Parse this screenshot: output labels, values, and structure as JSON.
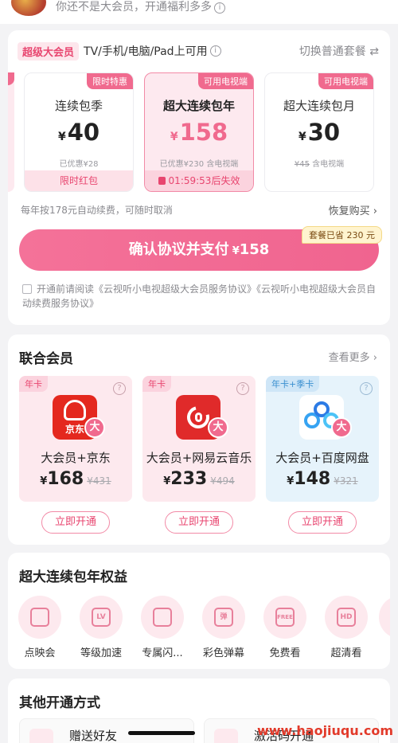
{
  "top": {
    "subtitle": "你还不是大会员，开通福利多多"
  },
  "plans_card": {
    "badge": "超级大会员",
    "devices": "TV/手机/电脑/Pad上可用",
    "switch": "切换普通套餐 ⇄",
    "plans": [
      {
        "tag": "限时特惠",
        "name": "连续包季",
        "currency": "¥",
        "price": "40",
        "note_prefix": "已优惠¥28",
        "note_strike": "",
        "note_suffix": "",
        "bottom": "限时红包"
      },
      {
        "tag": "可用电视端",
        "name": "超大连续包年",
        "currency": "¥",
        "price": "158",
        "note_prefix": "已优惠¥230",
        "note_strike": "",
        "note_suffix": "含电视端",
        "bottom": "01:59:53后失效"
      },
      {
        "tag": "可用电视端",
        "name": "超大连续包月",
        "currency": "¥",
        "price": "30",
        "note_prefix": "",
        "note_strike": "¥45",
        "note_suffix": "含电视端",
        "bottom": ""
      }
    ],
    "renew_note": "每年按178元自动续费，可随时取消",
    "restore": "恢复购买 ›",
    "pay_label": "确认协议并支付",
    "pay_currency": "¥",
    "pay_price": "158",
    "save_chip": "套餐已省 230 元",
    "agreement": "开通前请阅读《云视听小电视超级大会员服务协议》《云视听小电视超级大会员自动续费服务协议》"
  },
  "joint_card": {
    "title": "联合会员",
    "see_more": "查看更多 ›",
    "items": [
      {
        "tag": "年卡",
        "logo_text": "京东",
        "name": "大会员+京东",
        "currency": "¥",
        "price": "168",
        "orig": "¥431",
        "button": "立即开通"
      },
      {
        "tag": "年卡",
        "logo_text": "",
        "name": "大会员+网易云音乐",
        "currency": "¥",
        "price": "233",
        "orig": "¥494",
        "button": "立即开通"
      },
      {
        "tag": "年卡+季卡",
        "logo_text": "",
        "name": "大会员+百度网盘",
        "currency": "¥",
        "price": "148",
        "orig": "¥321",
        "button": "立即开通"
      }
    ],
    "da_badge": "大",
    "help": "?"
  },
  "benefits_card": {
    "title": "超大连续包年权益",
    "items": [
      {
        "label": "点映会",
        "glyph": ""
      },
      {
        "label": "等级加速",
        "glyph": "LV"
      },
      {
        "label": "专属闪...",
        "glyph": ""
      },
      {
        "label": "彩色弹幕",
        "glyph": "弹"
      },
      {
        "label": "免费看",
        "glyph": "FREE"
      },
      {
        "label": "超清看",
        "glyph": "HD"
      }
    ]
  },
  "other_card": {
    "title": "其他开通方式",
    "items": [
      {
        "label": "赠送好友"
      },
      {
        "label": "激活码开通"
      }
    ]
  },
  "watermark": "www.haojiuqu.com"
}
